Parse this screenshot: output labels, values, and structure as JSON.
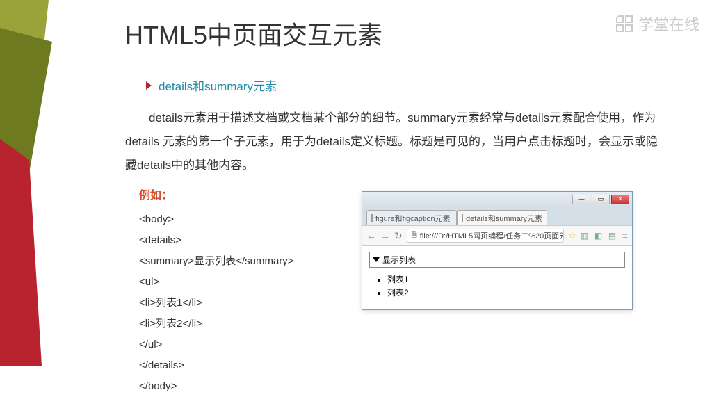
{
  "logo_text": "学堂在线",
  "title": "HTML5中页面交互元素",
  "section_bullet": "details和summary元素",
  "paragraph": "details元素用于描述文档或文档某个部分的细节。summary元素经常与details元素配合使用，作为details 元素的第一个子元素，用于为details定义标题。标题是可见的，当用户点击标题时，会显示或隐藏details中的其他内容。",
  "example_label": "例如：",
  "code_lines": [
    "<body>",
    "<details>",
    "<summary>显示列表</summary>",
    "<ul>",
    "<li>列表1</li>",
    "<li>列表2</li>",
    "</ul>",
    "</details>",
    "</body>"
  ],
  "browser": {
    "tabs": [
      {
        "label": "figure和figcaption元素",
        "active": false
      },
      {
        "label": "details和summary元素",
        "active": true
      }
    ],
    "url_prefix": "file:///D:/HTML5网页编程/任务二%20页面元...",
    "summary_text": "显示列表",
    "list_items": [
      "列表1",
      "列表2"
    ]
  }
}
